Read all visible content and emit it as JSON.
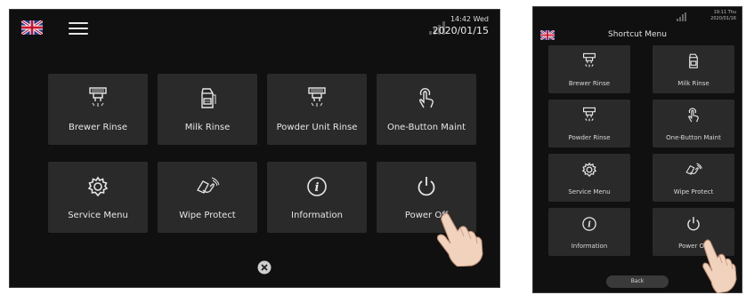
{
  "left_screen": {
    "clock_time": "14:42 Wed",
    "clock_date": "2020/01/15",
    "tiles": [
      {
        "label": "Brewer Rinse",
        "icon": "brewer-rinse-icon"
      },
      {
        "label": "Milk Rinse",
        "icon": "milk-rinse-icon"
      },
      {
        "label": "Powder Unit Rinse",
        "icon": "powder-unit-rinse-icon"
      },
      {
        "label": "One-Button Maint",
        "icon": "touch-finger-icon"
      },
      {
        "label": "Service Menu",
        "icon": "gear-icon"
      },
      {
        "label": "Wipe Protect",
        "icon": "wipe-protect-icon"
      },
      {
        "label": "Information",
        "icon": "info-icon"
      },
      {
        "label": "Power Off",
        "icon": "power-icon"
      }
    ],
    "close_icon": "close-circle-icon"
  },
  "right_screen": {
    "clock_time": "19:11 Thu",
    "clock_date": "2020/01/16",
    "title": "Shortcut Menu",
    "tiles": [
      {
        "label": "Brewer Rinse",
        "icon": "brewer-rinse-icon"
      },
      {
        "label": "Milk Rinse",
        "icon": "milk-rinse-icon"
      },
      {
        "label": "Powder Rinse",
        "icon": "powder-rinse-icon"
      },
      {
        "label": "One-Button Maint",
        "icon": "touch-finger-icon"
      },
      {
        "label": "Service Menu",
        "icon": "gear-icon"
      },
      {
        "label": "Wipe Protect",
        "icon": "wipe-protect-icon"
      },
      {
        "label": "Information",
        "icon": "info-icon"
      },
      {
        "label": "Power Off",
        "icon": "power-icon"
      }
    ],
    "back_label": "Back"
  },
  "colors": {
    "screen_bg": "#101010",
    "tile_bg": "#2a2a2a",
    "text": "#e6e6e6"
  }
}
